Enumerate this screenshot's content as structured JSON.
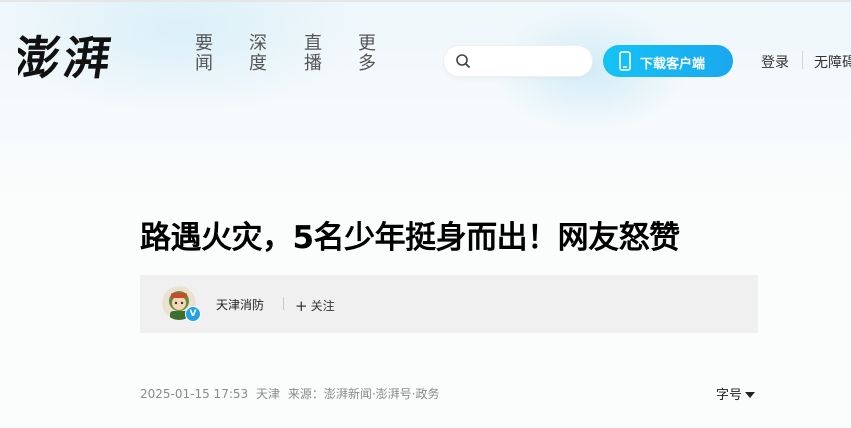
{
  "site": {
    "logo_text": "澎湃"
  },
  "nav": {
    "items": [
      {
        "label": "要闻"
      },
      {
        "label": "深度"
      },
      {
        "label": "直播"
      },
      {
        "label": "更多"
      }
    ]
  },
  "search": {
    "placeholder": "",
    "value": "",
    "icon": "search-icon"
  },
  "header_actions": {
    "download_label": "下载客户端",
    "download_icon": "phone-icon",
    "login_label": "登录",
    "accessibility_label": "无障碍"
  },
  "article": {
    "title": "路遇火灾，5名少年挺身而出！网友怒赞",
    "author": {
      "name": "天津消防",
      "verified_badge": "V",
      "follow_label": "关注"
    },
    "meta": {
      "datetime": "2025-01-15 17:53",
      "location": "天津",
      "source": "来源：澎湃新闻·澎湃号·政务"
    },
    "font_size_label": "字号"
  },
  "colors": {
    "accent": "#1ab4f2",
    "title": "#000000",
    "meta": "#8a8a8a"
  }
}
